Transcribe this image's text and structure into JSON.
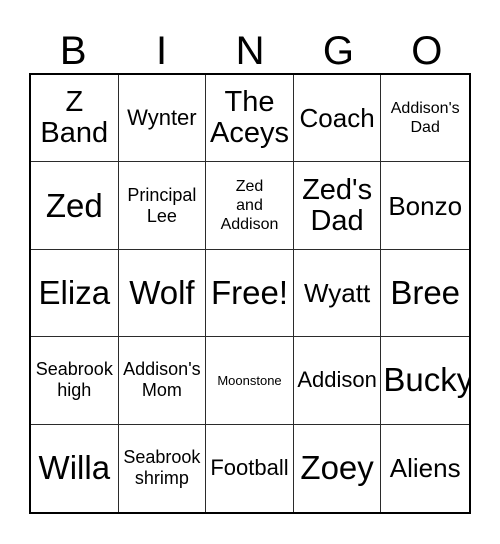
{
  "card": {
    "header_letters": [
      "B",
      "I",
      "N",
      "G",
      "O"
    ],
    "grid": {
      "columns": 5,
      "rows": 5,
      "free_space_label": "Free!",
      "free_space_position": "center",
      "border_color": "#000000",
      "cell_border_color": "#2b2b2b",
      "background_color": "#ffffff",
      "text_color": "#000000"
    },
    "cells": [
      {
        "text": "Z\nBand",
        "size": "xl"
      },
      {
        "text": "Wynter",
        "size": "md"
      },
      {
        "text": "The\nAceys",
        "size": "xl"
      },
      {
        "text": "Coach",
        "size": "lg"
      },
      {
        "text": "Addison's\nDad",
        "size": "xs"
      },
      {
        "text": "Zed",
        "size": "xxl"
      },
      {
        "text": "Principal\nLee",
        "size": "sm"
      },
      {
        "text": "Zed\nand\nAddison",
        "size": "xs"
      },
      {
        "text": "Zed's\nDad",
        "size": "xl"
      },
      {
        "text": "Bonzo",
        "size": "lg"
      },
      {
        "text": "Eliza",
        "size": "xxl"
      },
      {
        "text": "Wolf",
        "size": "xxl"
      },
      {
        "text": "Free!",
        "size": "xxl"
      },
      {
        "text": "Wyatt",
        "size": "lg"
      },
      {
        "text": "Bree",
        "size": "xxl"
      },
      {
        "text": "Seabrook\nhigh",
        "size": "sm"
      },
      {
        "text": "Addison's\nMom",
        "size": "sm"
      },
      {
        "text": "Moonstone",
        "size": "xxs"
      },
      {
        "text": "Addison",
        "size": "md"
      },
      {
        "text": "Bucky",
        "size": "xxl"
      },
      {
        "text": "Willa",
        "size": "xxl"
      },
      {
        "text": "Seabrook\nshrimp",
        "size": "sm"
      },
      {
        "text": "Football",
        "size": "md"
      },
      {
        "text": "Zoey",
        "size": "xxl"
      },
      {
        "text": "Aliens",
        "size": "lg"
      }
    ]
  }
}
